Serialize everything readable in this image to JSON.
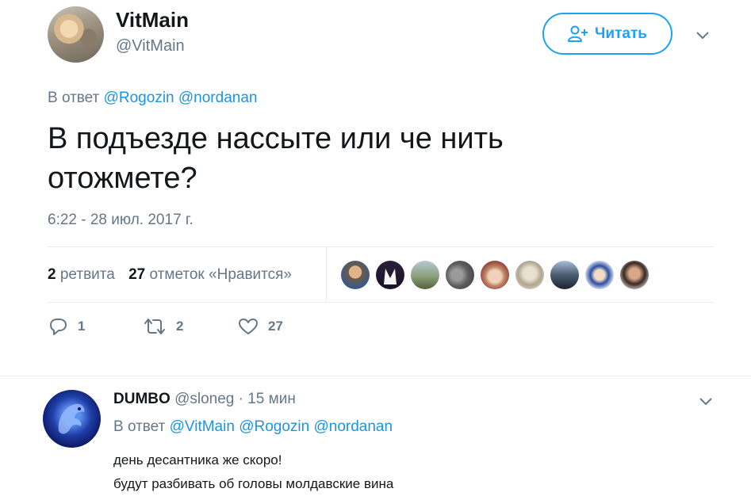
{
  "author": {
    "name": "VitMain",
    "handle": "@VitMain"
  },
  "follow_button": {
    "label": "Читать",
    "icon": "add-user-icon"
  },
  "tweet": {
    "reply_prefix": "В ответ",
    "mentions": [
      "@Rogozin",
      "@nordanan"
    ],
    "text_line1": "В подъезде нассыте или че нить",
    "text_line2": "отожмете?",
    "timestamp": "6:22 - 28 июл. 2017 г."
  },
  "stats": {
    "retweets_count": "2",
    "retweets_label": "ретвита",
    "likes_count": "27",
    "likes_label": "отметок «Нравится»"
  },
  "likers": [
    "avatar-1",
    "avatar-2",
    "avatar-3",
    "avatar-4",
    "avatar-5",
    "avatar-6",
    "avatar-7",
    "avatar-8",
    "avatar-9"
  ],
  "actions": {
    "reply_count": "1",
    "retweet_count": "2",
    "like_count": "27"
  },
  "reply": {
    "name": "DUMBO",
    "handle": "@sloneg",
    "separator": "·",
    "time": "15 мин",
    "reply_prefix": "В ответ",
    "mentions": [
      "@VitMain",
      "@Rogozin",
      "@nordanan"
    ],
    "line1": "день десантника же скоро!",
    "line2": "будут разбивать об головы молдавские вина"
  },
  "colors": {
    "accent": "#1da1f2",
    "link": "#1b95e0",
    "secondary_text": "#657786",
    "primary_text": "#14171a",
    "divider": "#e6ecf0"
  }
}
